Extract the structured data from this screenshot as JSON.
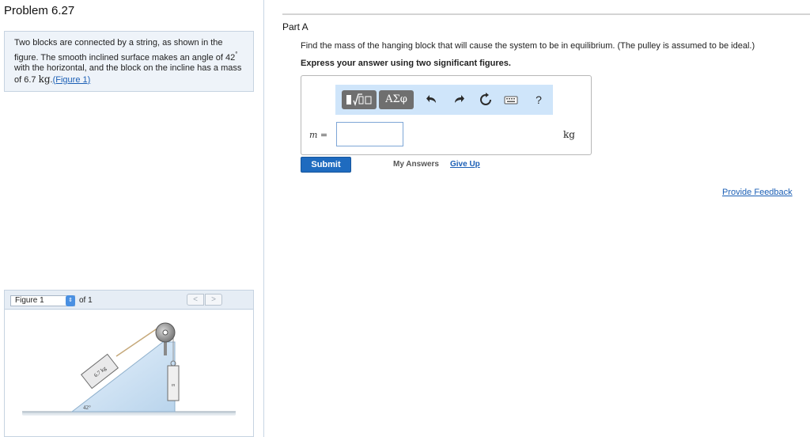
{
  "problem": {
    "title": "Problem 6.27",
    "text_before": "Two blocks are connected by a string, as shown in the figure. The smooth inclined surface makes an angle of 42",
    "degree_symbol": "°",
    "text_after": " with the horizontal, and the block on the incline has a mass of 6.7 ",
    "mass_unit": "kg",
    "text_end": ".",
    "figure_link": "(Figure 1)"
  },
  "figure": {
    "select_value": "Figure 1",
    "of_text": "of 1",
    "prev_label": "<",
    "next_label": ">",
    "block_label": "6.7 kg",
    "angle_label": "42°",
    "hanging_label": "m"
  },
  "part": {
    "label": "Part A",
    "question": "Find the mass of the hanging block that will cause the system to be in equilibrium. (The pulley is assumed to be ideal.)",
    "instruction": "Express your answer using two significant figures."
  },
  "answer": {
    "var_label": "m =",
    "input_value": "",
    "unit": "kg",
    "greek_label": "ΑΣφ",
    "help_label": "?"
  },
  "actions": {
    "submit": "Submit",
    "my_answers": "My Answers",
    "give_up": "Give Up",
    "feedback": "Provide Feedback"
  },
  "icons": {
    "template": "template-icon",
    "undo": "undo-icon",
    "redo": "redo-icon",
    "reset": "reset-icon",
    "keyboard": "keyboard-icon",
    "help": "help-icon"
  },
  "colors": {
    "accent": "#1f6bbf",
    "link": "#1b5fb5",
    "toolbar_bg": "#cfe5fa"
  }
}
